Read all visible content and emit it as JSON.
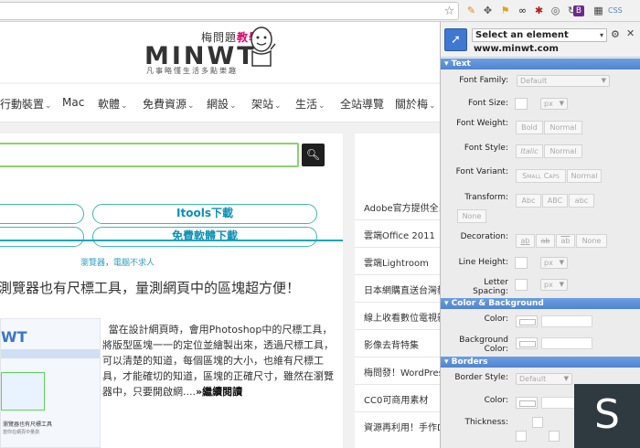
{
  "toolbar": {
    "icons": [
      "star-icon",
      "extension-pen-icon",
      "move-icon",
      "flag-icon",
      "glasses-icon",
      "spider-icon",
      "camera-icon",
      "refresh-icon",
      "bold-b-icon",
      "grid-icon",
      "css-icon"
    ],
    "css_label": "CSS"
  },
  "site": {
    "logo_sub_black": "梅問題",
    "logo_sub_pink": "教學網",
    "logo_main": "MINWT",
    "logo_tag": "凡事略懂生活多點樂趣",
    "nav": [
      "行動裝置",
      "Mac",
      "軟體",
      "免費資源",
      "網設",
      "架站",
      "生活",
      "全站導覽",
      "關於梅"
    ],
    "search_icon": "search-icon",
    "pill_1": "Itools下載",
    "pill_2": "免費軟體下載",
    "category": "瀏覽器",
    "category_sep": "，",
    "category_2": "電腦不求人",
    "post_title": "測覽器也有尺標工具，量測網頁中的區塊超方便！",
    "thumb_logo": "WT",
    "thumb_caption": "瀏覽器也有尺標工具",
    "thumb_sub": "當你在網頁中量測",
    "post_body": "當在設計網頁時，會用Photoshop中的尺標工具，將版型區塊一一的定位並繪製出來，透過尺標工具，可以清楚的知道，每個區塊的大小，也維有尺標工具，才能確切的知道，區塊的正確尺寸，雖然在瀏覽器中，只要開啟網....",
    "more": "»繼續閱讀",
    "sidebar": [
      "Adobe官方提供全系",
      "雲端Office 2011",
      "雲端Lightroom",
      "日本網購直送台灣教",
      "線上收看數位電視新",
      "影像去背特集",
      "梅問發！WordPress",
      "CC0可商用素材",
      "資源再利用！手作D"
    ]
  },
  "panel": {
    "select_label": "Select an element",
    "url": "www.minwt.com",
    "sections": {
      "text": "Text",
      "color_bg": "Color & Background",
      "borders": "Borders"
    },
    "labels": {
      "font_family": "Font Family:",
      "font_size": "Font Size:",
      "font_weight": "Font Weight:",
      "font_style": "Font Style:",
      "font_variant": "Font Variant:",
      "transform": "Transform:",
      "decoration": "Decoration:",
      "line_height": "Line Height:",
      "letter_spacing": "Letter Spacing:",
      "color": "Color:",
      "bg_color": "Background Color:",
      "border_style": "Border Style:",
      "border_color": "Color:",
      "thickness": "Thickness:"
    },
    "values": {
      "font_family": "Default",
      "unit_px": "px",
      "border_style": "Default"
    },
    "buttons": {
      "bold": "Bold",
      "normal": "Normal",
      "italic": "Italic",
      "small_caps": "Small Caps",
      "abc_lower": "Abc",
      "abc_upper": "ABC",
      "abc": "abc",
      "none": "None",
      "underline": "ab",
      "strike": "ab",
      "overline": "ab"
    }
  },
  "overlay": {
    "letter": "S"
  }
}
